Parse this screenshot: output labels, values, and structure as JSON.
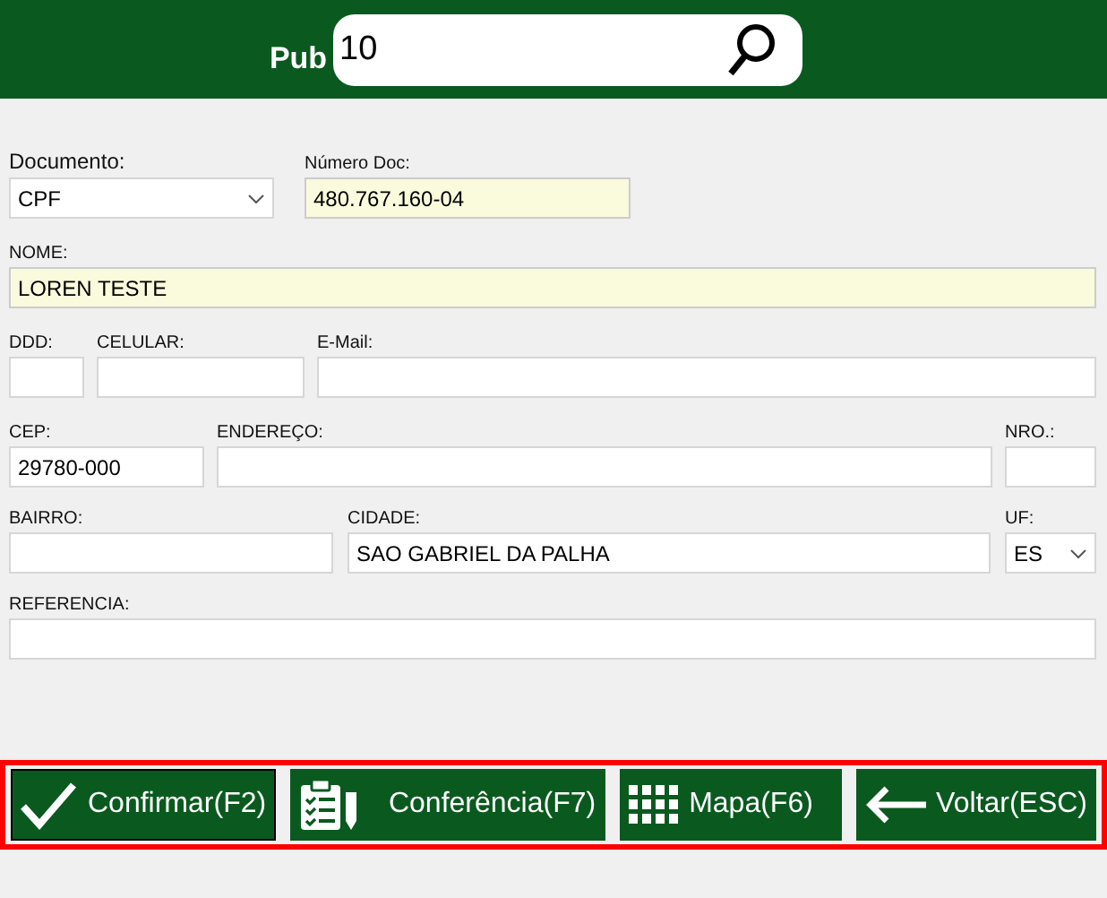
{
  "header": {
    "label": "Pub",
    "search": {
      "value": "10"
    }
  },
  "rows": [
    [
      {
        "label": "Documento:",
        "kind": "select",
        "value": "CPF",
        "highlighted": false
      },
      {
        "label": "Número Doc:",
        "kind": "text",
        "value": "480.767.160-04",
        "highlighted": true
      }
    ],
    [
      {
        "label": "NOME:",
        "kind": "text",
        "value": "LOREN TESTE",
        "highlighted": true
      }
    ],
    [
      {
        "label": "DDD:",
        "kind": "text",
        "highlighted": false
      },
      {
        "label": "CELULAR:",
        "kind": "text",
        "highlighted": false
      },
      {
        "label": "E-Mail:",
        "kind": "text",
        "highlighted": false
      }
    ],
    [
      {
        "label": "CEP:",
        "kind": "text",
        "value": "29780-000",
        "highlighted": false
      },
      {
        "label": "ENDEREÇO:",
        "kind": "text",
        "highlighted": false
      },
      {
        "label": "NRO.:",
        "kind": "text",
        "highlighted": false
      }
    ],
    [
      {
        "label": "BAIRRO:",
        "kind": "text",
        "highlighted": false
      },
      {
        "label": "CIDADE:",
        "kind": "text",
        "value": "SAO GABRIEL DA PALHA",
        "highlighted": false
      },
      {
        "label": "UF:",
        "kind": "select",
        "value": "ES",
        "highlighted": false
      }
    ],
    [
      {
        "label": "REFERENCIA:",
        "kind": "text",
        "highlighted": false
      }
    ]
  ],
  "buttons": [
    {
      "label": "Confirmar(F2)",
      "kind": "check",
      "focused": true
    },
    {
      "label": "Conferência(F7)",
      "kind": "clipboard",
      "focused": false
    },
    {
      "label": "Mapa(F6)",
      "kind": "grid",
      "focused": false
    },
    {
      "label": "Voltar(ESC)",
      "kind": "back",
      "focused": false
    }
  ]
}
